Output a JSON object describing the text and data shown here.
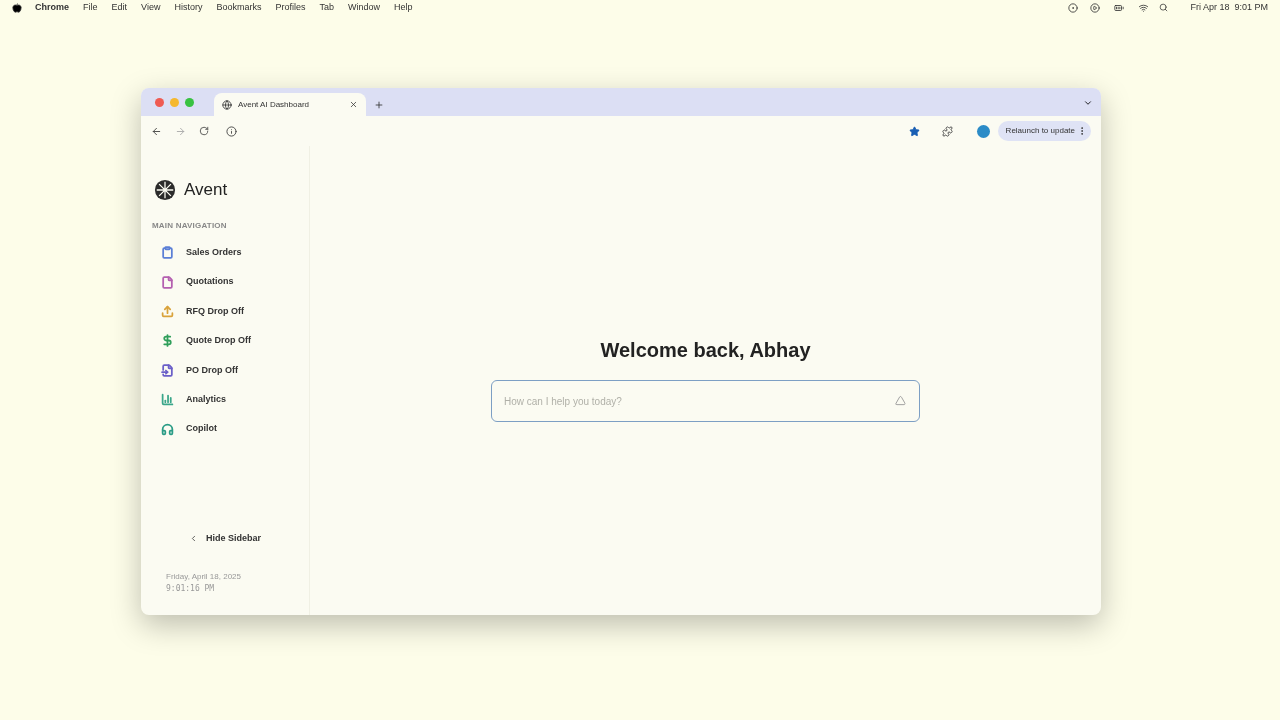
{
  "menu_bar": {
    "app": "Chrome",
    "items": [
      "File",
      "Edit",
      "View",
      "History",
      "Bookmarks",
      "Profiles",
      "Tab",
      "Window",
      "Help"
    ],
    "clock": "Fri Apr 18  9:01 PM"
  },
  "browser": {
    "tab_title": "Avent AI Dashboard",
    "relaunch": "Relaunch to update"
  },
  "sidebar": {
    "brand": "Avent",
    "section": "MAIN NAVIGATION",
    "items": [
      {
        "label": "Sales Orders",
        "color": "#5b7fd6"
      },
      {
        "label": "Quotations",
        "color": "#b45fb0"
      },
      {
        "label": "RFQ Drop Off",
        "color": "#d9a23a"
      },
      {
        "label": "Quote Drop Off",
        "color": "#2f9e5a"
      },
      {
        "label": "PO Drop Off",
        "color": "#6a5fc8"
      },
      {
        "label": "Analytics",
        "color": "#3aa68a"
      },
      {
        "label": "Copilot",
        "color": "#2a9c86"
      }
    ],
    "hide": "Hide Sidebar",
    "date": "Friday, April 18, 2025",
    "time": "9:01:16 PM"
  },
  "main": {
    "heading": "Welcome back, Abhay",
    "placeholder": "How can I help you today?"
  }
}
